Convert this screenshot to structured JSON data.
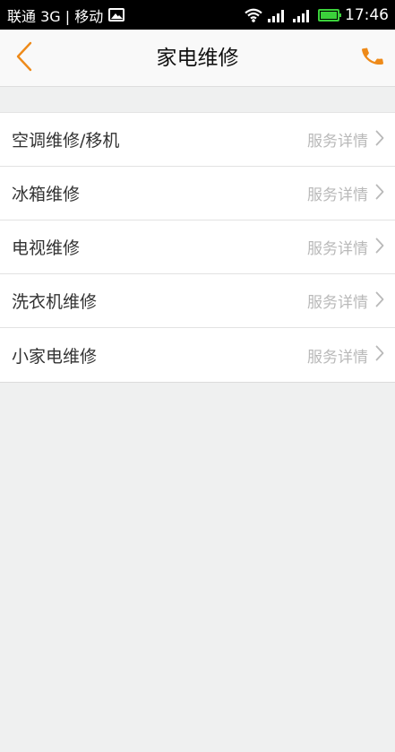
{
  "status_bar": {
    "carrier": "联通 3G | 移动",
    "time": "17:46",
    "icons": [
      "gallery-icon",
      "wifi-icon",
      "signal-icon",
      "signal-icon",
      "battery-icon"
    ]
  },
  "header": {
    "title": "家电维修",
    "back_icon": "chevron-left-icon",
    "call_icon": "phone-icon"
  },
  "colors": {
    "accent": "#ee8a19",
    "background": "#eff0f0",
    "row_text": "#333333",
    "detail_text": "#b9b9b9",
    "battery": "#3bd13b"
  },
  "services": [
    {
      "name": "空调维修/移机",
      "detail": "服务详情"
    },
    {
      "name": "冰箱维修",
      "detail": "服务详情"
    },
    {
      "name": "电视维修",
      "detail": "服务详情"
    },
    {
      "name": "洗衣机维修",
      "detail": "服务详情"
    },
    {
      "name": "小家电维修",
      "detail": "服务详情"
    }
  ]
}
